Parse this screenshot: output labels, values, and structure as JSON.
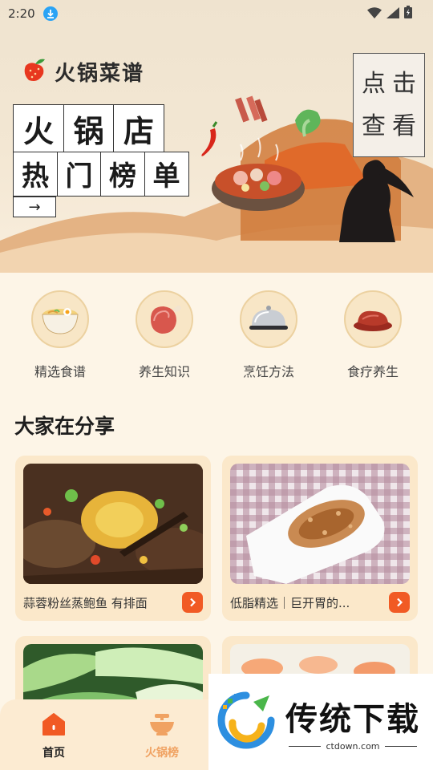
{
  "status_bar": {
    "time": "2:20"
  },
  "hero": {
    "app_name": "火锅菜谱",
    "title_row1": [
      "火",
      "锅",
      "店"
    ],
    "title_row2": [
      "热",
      "门",
      "榜",
      "单"
    ],
    "arrow": "→",
    "click_chars": [
      "点",
      "击",
      "查",
      "看"
    ]
  },
  "categories": [
    {
      "label": "精选食谱",
      "icon": "noodle-bowl-icon"
    },
    {
      "label": "养生知识",
      "icon": "ham-icon"
    },
    {
      "label": "烹饪方法",
      "icon": "cloche-icon"
    },
    {
      "label": "食疗养生",
      "icon": "meat-dish-icon"
    }
  ],
  "section": {
    "title": "大家在分享"
  },
  "cards": [
    {
      "text": "蒜蓉粉丝蒸鲍鱼 有排面"
    },
    {
      "text": "低脂精选｜巨开胃的..."
    },
    {
      "text": ""
    },
    {
      "text": ""
    }
  ],
  "nav": {
    "home_label": "首页",
    "hotpot_label": "火锅榜"
  },
  "watermark": {
    "title": "传统下载",
    "url": "ctdown.com"
  },
  "colors": {
    "accent": "#f15a24",
    "card_bg": "#fbe8ca",
    "nav_bg": "#fcebd2",
    "inactive_nav": "#f0a262"
  }
}
